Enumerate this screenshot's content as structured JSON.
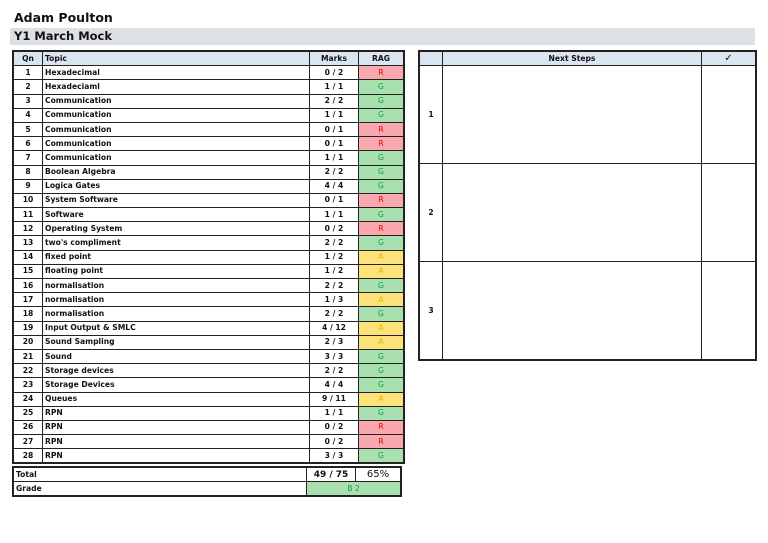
{
  "student_name": "Adam Poulton",
  "assessment": "Y1 March Mock",
  "headers": {
    "qn": "Qn",
    "topic": "Topic",
    "marks": "Marks",
    "rag": "RAG"
  },
  "rows": [
    {
      "qn": "1",
      "topic": "Hexadecimal",
      "marks": "0 / 2",
      "rag": "R"
    },
    {
      "qn": "2",
      "topic": "Hexadeciaml",
      "marks": "1 / 1",
      "rag": "G"
    },
    {
      "qn": "3",
      "topic": "Communication",
      "marks": "2 / 2",
      "rag": "G"
    },
    {
      "qn": "4",
      "topic": "Communication",
      "marks": "1 / 1",
      "rag": "G"
    },
    {
      "qn": "5",
      "topic": "Communication",
      "marks": "0 / 1",
      "rag": "R"
    },
    {
      "qn": "6",
      "topic": "Communication",
      "marks": "0 / 1",
      "rag": "R"
    },
    {
      "qn": "7",
      "topic": "Communication",
      "marks": "1 / 1",
      "rag": "G"
    },
    {
      "qn": "8",
      "topic": "Boolean Algebra",
      "marks": "2 / 2",
      "rag": "G"
    },
    {
      "qn": "9",
      "topic": "Logica Gates",
      "marks": "4 / 4",
      "rag": "G"
    },
    {
      "qn": "10",
      "topic": "System Software",
      "marks": "0 / 1",
      "rag": "R"
    },
    {
      "qn": "11",
      "topic": "Software",
      "marks": "1 / 1",
      "rag": "G"
    },
    {
      "qn": "12",
      "topic": "Operating System",
      "marks": "0 / 2",
      "rag": "R"
    },
    {
      "qn": "13",
      "topic": "two's compliment",
      "marks": "2 / 2",
      "rag": "G"
    },
    {
      "qn": "14",
      "topic": "fixed point",
      "marks": "1 / 2",
      "rag": "A"
    },
    {
      "qn": "15",
      "topic": "floating point",
      "marks": "1 / 2",
      "rag": "A"
    },
    {
      "qn": "16",
      "topic": "normalisation",
      "marks": "2 / 2",
      "rag": "G"
    },
    {
      "qn": "17",
      "topic": "normalisation",
      "marks": "1 / 3",
      "rag": "A"
    },
    {
      "qn": "18",
      "topic": "normalisation",
      "marks": "2 / 2",
      "rag": "G"
    },
    {
      "qn": "19",
      "topic": "Input Output & SMLC",
      "marks": "4 / 12",
      "rag": "A"
    },
    {
      "qn": "20",
      "topic": "Sound Sampling",
      "marks": "2 / 3",
      "rag": "A"
    },
    {
      "qn": "21",
      "topic": "Sound",
      "marks": "3 / 3",
      "rag": "G"
    },
    {
      "qn": "22",
      "topic": "Storage devices",
      "marks": "2 / 2",
      "rag": "G"
    },
    {
      "qn": "23",
      "topic": "Storage Devices",
      "marks": "4 / 4",
      "rag": "G"
    },
    {
      "qn": "24",
      "topic": "Queues",
      "marks": "9 / 11",
      "rag": "A"
    },
    {
      "qn": "25",
      "topic": "RPN",
      "marks": "1 / 1",
      "rag": "G"
    },
    {
      "qn": "26",
      "topic": "RPN",
      "marks": "0 / 2",
      "rag": "R"
    },
    {
      "qn": "27",
      "topic": "RPN",
      "marks": "0 / 2",
      "rag": "R"
    },
    {
      "qn": "28",
      "topic": "RPN",
      "marks": "3 / 3",
      "rag": "G"
    }
  ],
  "total": {
    "label": "Total",
    "marks": "49 / 75",
    "percent": "65%"
  },
  "grade": {
    "label": "Grade",
    "value": "B 2"
  },
  "next_steps": {
    "header": "Next Steps",
    "check": "✓",
    "rows": [
      {
        "n": "1",
        "text": ""
      },
      {
        "n": "2",
        "text": ""
      },
      {
        "n": "3",
        "text": ""
      }
    ]
  }
}
